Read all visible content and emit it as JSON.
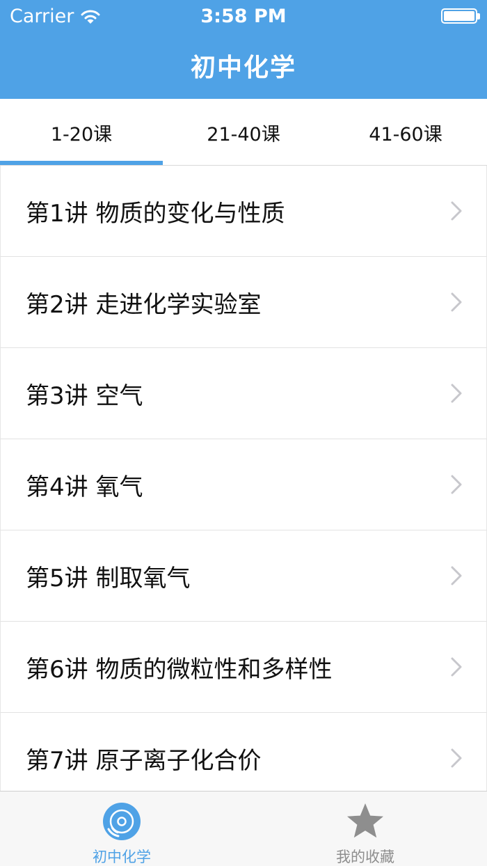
{
  "status_bar": {
    "carrier": "Carrier",
    "time": "3:58 PM"
  },
  "header": {
    "title": "初中化学"
  },
  "tabs": [
    {
      "label": "1-20课",
      "selected": true
    },
    {
      "label": "21-40课",
      "selected": false
    },
    {
      "label": "41-60课",
      "selected": false
    }
  ],
  "lessons": [
    {
      "label": "第1讲 物质的变化与性质"
    },
    {
      "label": "第2讲 走进化学实验室"
    },
    {
      "label": "第3讲 空气"
    },
    {
      "label": "第4讲 氧气"
    },
    {
      "label": "第5讲 制取氧气"
    },
    {
      "label": "第6讲 物质的微粒性和多样性"
    },
    {
      "label": "第7讲 原子离子化合价"
    }
  ],
  "tabbar": [
    {
      "label": "初中化学",
      "icon": "disc-icon",
      "active": true
    },
    {
      "label": "我的收藏",
      "icon": "star-icon",
      "active": false
    }
  ],
  "colors": {
    "accent": "#4fa2e6",
    "inactive": "#8e8e8e"
  }
}
